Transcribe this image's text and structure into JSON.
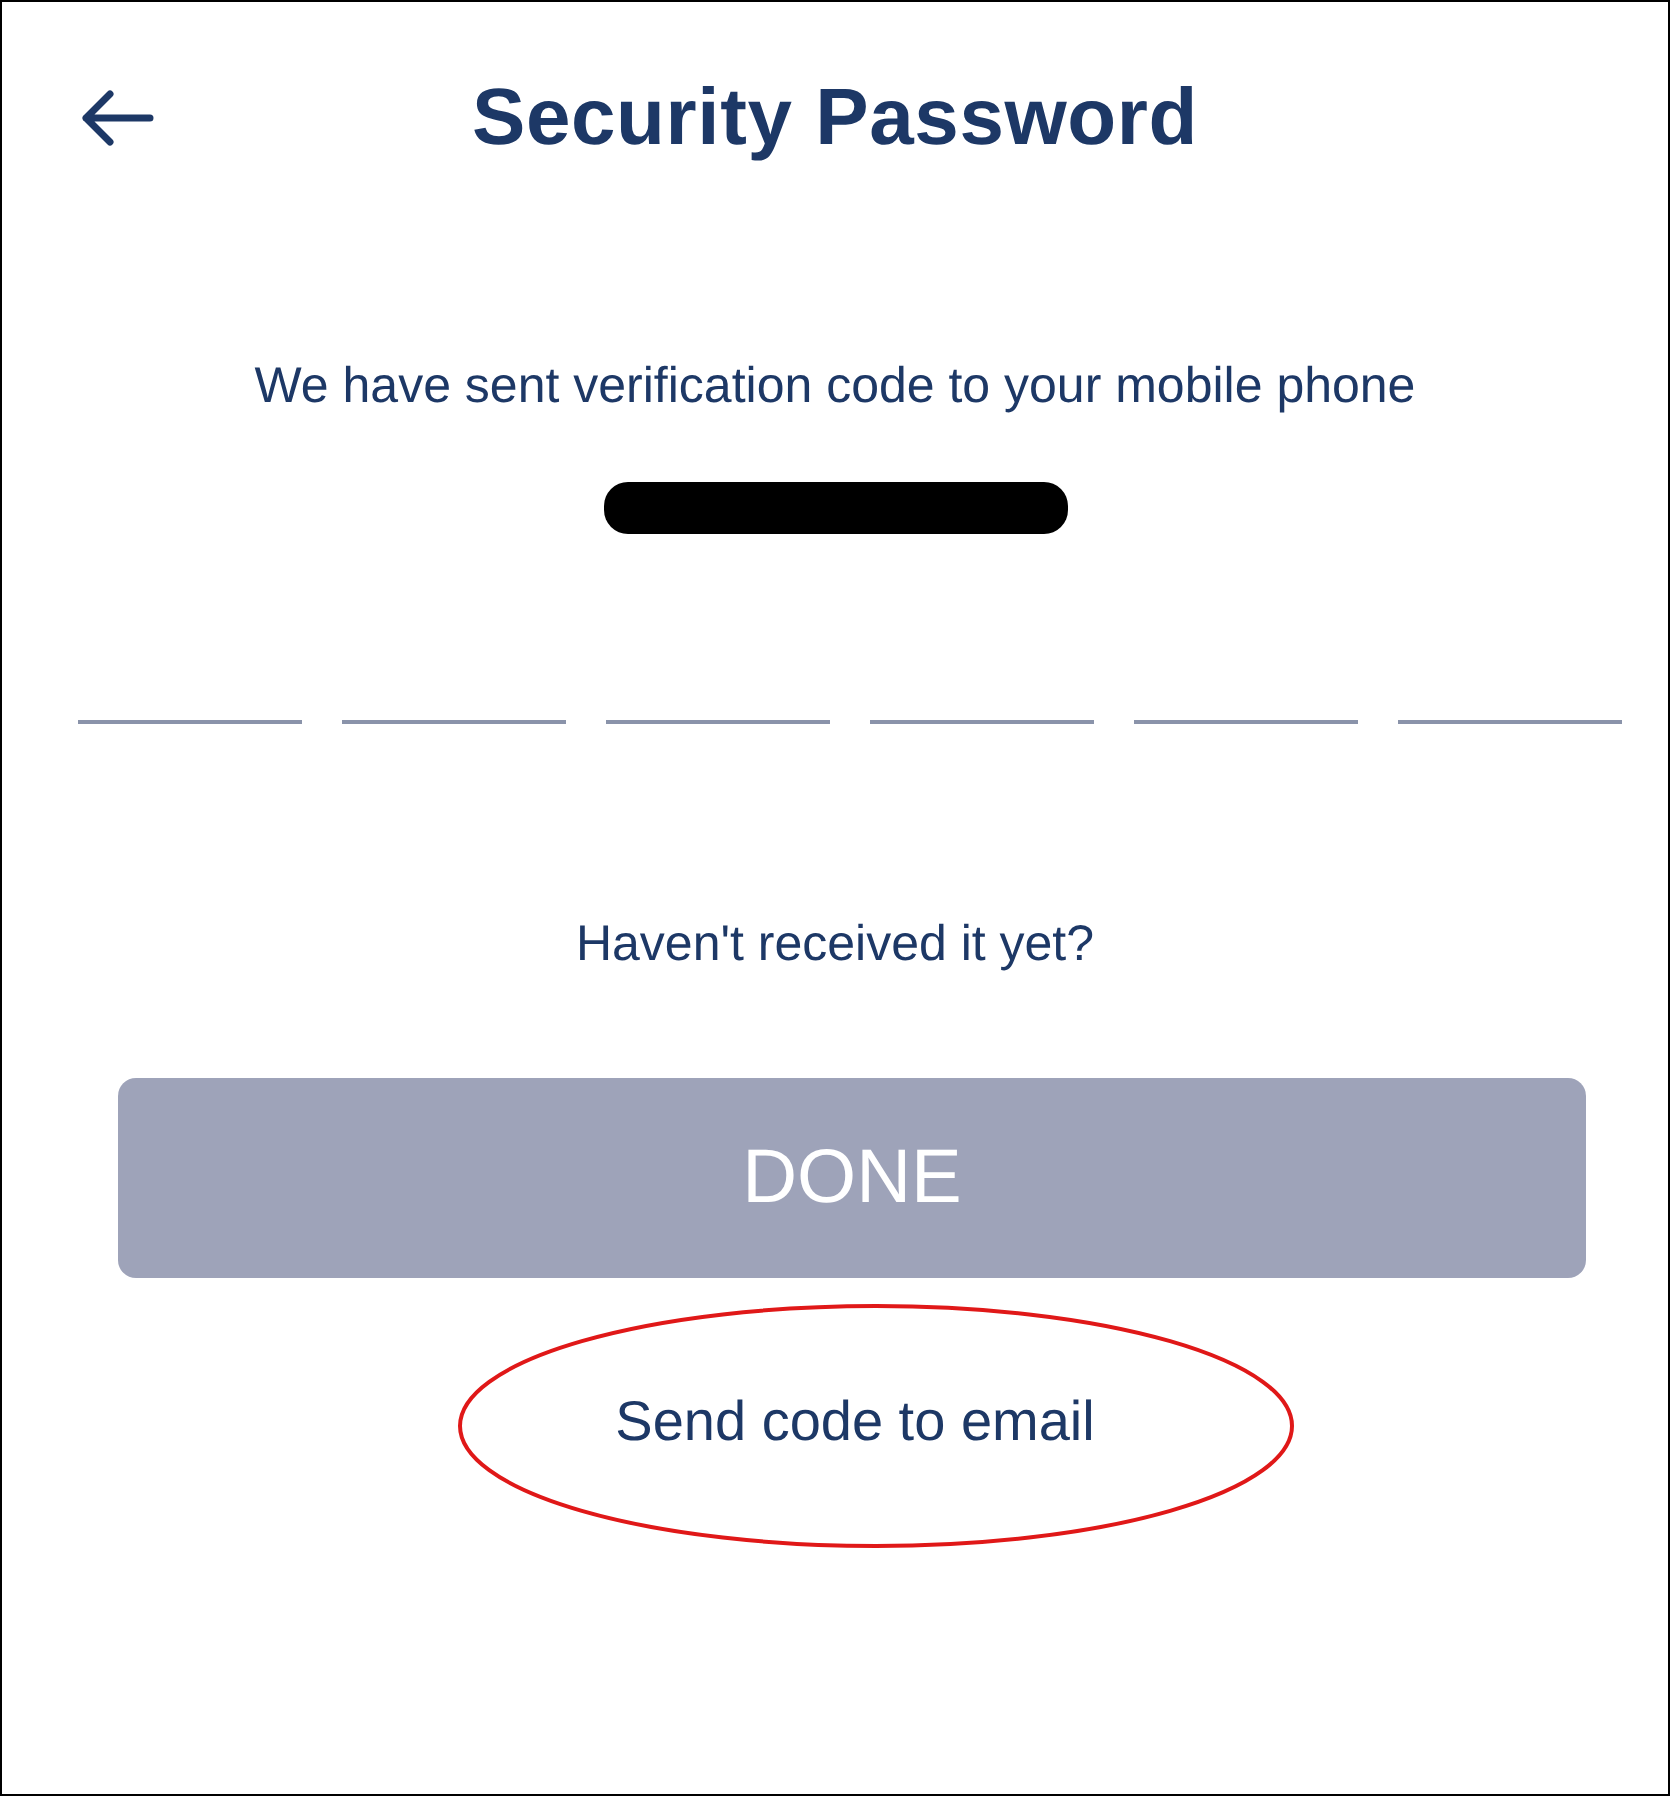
{
  "header": {
    "title": "Security Password"
  },
  "message": "We have sent verification code to your mobile phone",
  "phone": {
    "redacted": true
  },
  "code_inputs": [
    {
      "filled": false
    },
    {
      "filled": false
    },
    {
      "filled": false
    },
    {
      "filled": false
    },
    {
      "filled": false
    },
    {
      "filled": false
    }
  ],
  "resend_prompt": "Haven't received it yet?",
  "done_button": {
    "label": "DONE",
    "disabled": true
  },
  "email_link": {
    "label": "Send code to email",
    "circled": true
  }
}
